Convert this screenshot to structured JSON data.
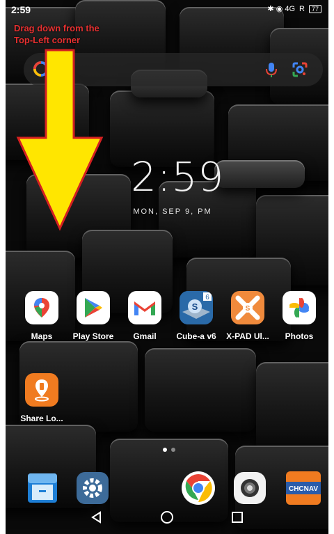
{
  "status_bar": {
    "time": "2:59",
    "indicators": "✱ ◉ 4G",
    "carrier": "R",
    "battery": "77"
  },
  "annotation": {
    "line1": "Drag down from the",
    "line2": "Top-Left corner"
  },
  "search_bar": {
    "icons": [
      "google-g-icon",
      "mic-icon",
      "lens-icon"
    ]
  },
  "clock": {
    "time": "2:59",
    "date": "MON, SEP 9, PM"
  },
  "home_apps": [
    {
      "label": "Maps",
      "icon": "maps-icon"
    },
    {
      "label": "Play Store",
      "icon": "play-store-icon"
    },
    {
      "label": "Gmail",
      "icon": "gmail-icon"
    },
    {
      "label": "Cube-a v6",
      "icon": "cube-a-icon"
    },
    {
      "label": "X-PAD Ul...",
      "icon": "xpad-icon"
    },
    {
      "label": "Photos",
      "icon": "photos-icon"
    },
    {
      "label": "Share Lo...",
      "icon": "share-location-icon"
    }
  ],
  "dock": [
    {
      "icon": "file-manager-icon"
    },
    {
      "icon": "settings-icon"
    },
    {
      "icon": "chrome-icon"
    },
    {
      "icon": "camera-icon"
    },
    {
      "icon": "chcnav-icon",
      "text": "CHCNAV"
    }
  ],
  "nav": [
    "back-icon",
    "home-icon",
    "recents-icon"
  ],
  "colors": {
    "annotation": "#e53030",
    "arrow_fill": "#ffe600",
    "arrow_stroke": "#d42020"
  }
}
